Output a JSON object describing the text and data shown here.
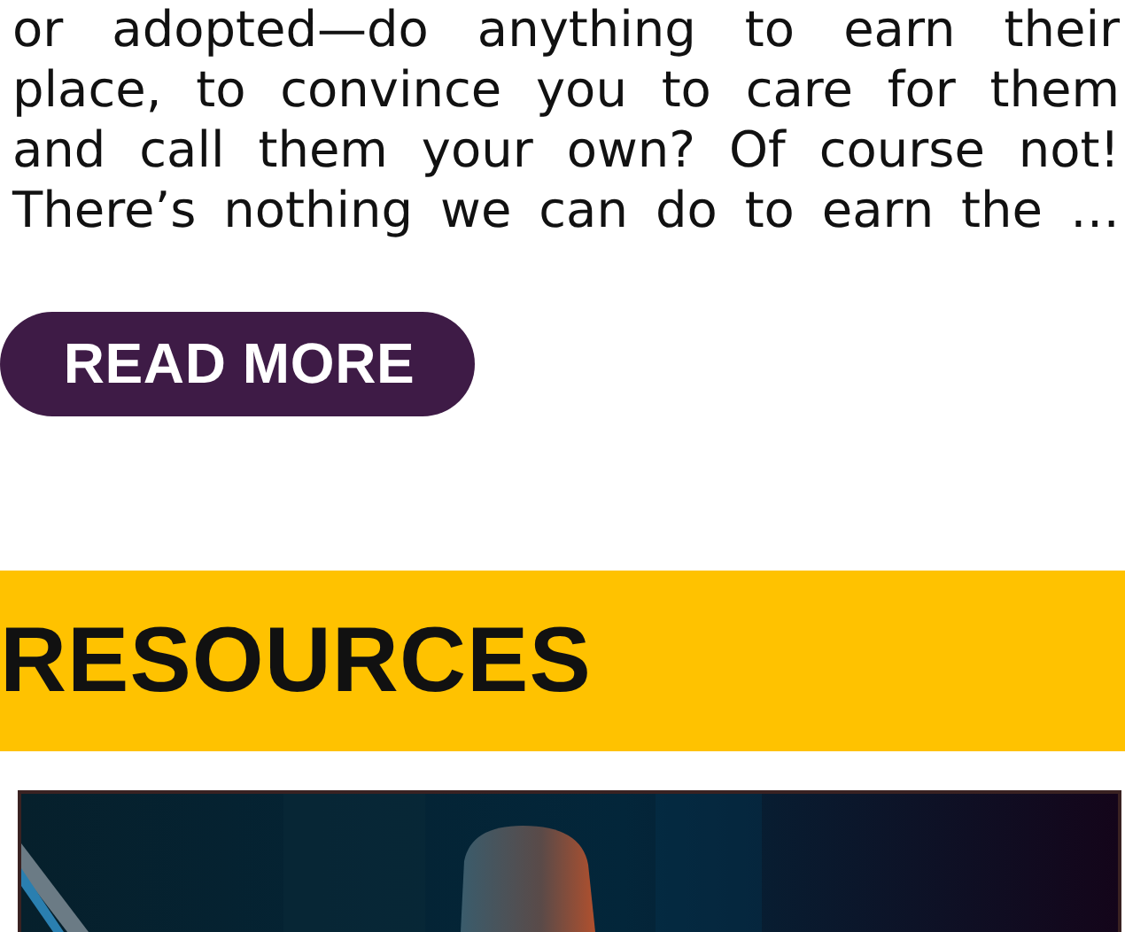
{
  "article": {
    "excerpt_lines": [
      "or adopted—do anything to earn their",
      "place, to convince you to care for them",
      "and call them your own? Of course not!",
      "There’s nothing we can do to earn the …"
    ],
    "button": "READ MORE"
  },
  "resources": {
    "heading": "RESOURCES"
  }
}
